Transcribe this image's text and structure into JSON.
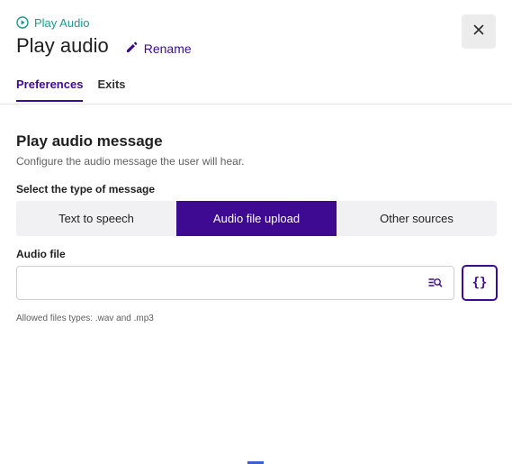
{
  "header": {
    "node_type": "Play Audio",
    "title": "Play audio",
    "rename_label": "Rename"
  },
  "tabs": [
    {
      "label": "Preferences",
      "active": true
    },
    {
      "label": "Exits",
      "active": false
    }
  ],
  "section": {
    "title": "Play audio message",
    "description": "Configure the audio message the user will hear."
  },
  "message_type": {
    "label": "Select the type of message",
    "options": [
      {
        "label": "Text to speech",
        "selected": false
      },
      {
        "label": "Audio file upload",
        "selected": true
      },
      {
        "label": "Other sources",
        "selected": false
      }
    ]
  },
  "audio_file": {
    "label": "Audio file",
    "value": "",
    "placeholder": "",
    "variable_button": "{}",
    "help_text": "Allowed files types: .wav and .mp3"
  },
  "colors": {
    "accent": "#3d0a91",
    "node_type": "#1a9a8f"
  },
  "icons": {
    "node_type": "play-circle-icon",
    "rename": "pencil-icon",
    "close": "close-icon",
    "browse": "search-list-icon"
  }
}
